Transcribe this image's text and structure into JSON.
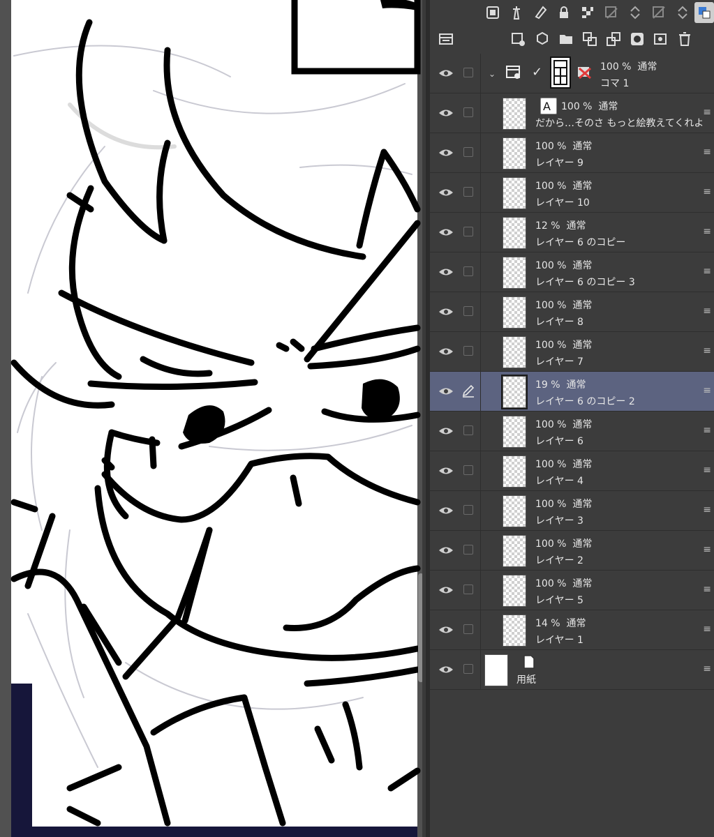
{
  "panel": {
    "folder": {
      "opacity": "100 %",
      "blend": "通常",
      "name": "コマ 1"
    },
    "text_layer": {
      "opacity": "100 %",
      "blend": "通常",
      "name": "だから…そのさ もっと絵教えてくれよ"
    },
    "layers": [
      {
        "opacity": "100 %",
        "blend": "通常",
        "name": "レイヤー 9"
      },
      {
        "opacity": "100 %",
        "blend": "通常",
        "name": "レイヤー 10"
      },
      {
        "opacity": "12 %",
        "blend": "通常",
        "name": "レイヤー 6 のコピー"
      },
      {
        "opacity": "100 %",
        "blend": "通常",
        "name": "レイヤー 6 のコピー 3"
      },
      {
        "opacity": "100 %",
        "blend": "通常",
        "name": "レイヤー 8"
      },
      {
        "opacity": "100 %",
        "blend": "通常",
        "name": "レイヤー 7"
      },
      {
        "opacity": "19 %",
        "blend": "通常",
        "name": "レイヤー 6 のコピー 2",
        "selected": true
      },
      {
        "opacity": "100 %",
        "blend": "通常",
        "name": "レイヤー 6"
      },
      {
        "opacity": "100 %",
        "blend": "通常",
        "name": "レイヤー 4"
      },
      {
        "opacity": "100 %",
        "blend": "通常",
        "name": "レイヤー 3"
      },
      {
        "opacity": "100 %",
        "blend": "通常",
        "name": "レイヤー 2"
      },
      {
        "opacity": "100 %",
        "blend": "通常",
        "name": "レイヤー 5"
      },
      {
        "opacity": "14 %",
        "blend": "通常",
        "name": "レイヤー 1"
      }
    ],
    "paper": {
      "name": "用紙"
    }
  },
  "colors": {
    "panel_bg": "#3c3c3c",
    "selected_row": "#5c6380",
    "canvas_bg": "#ffffff"
  }
}
